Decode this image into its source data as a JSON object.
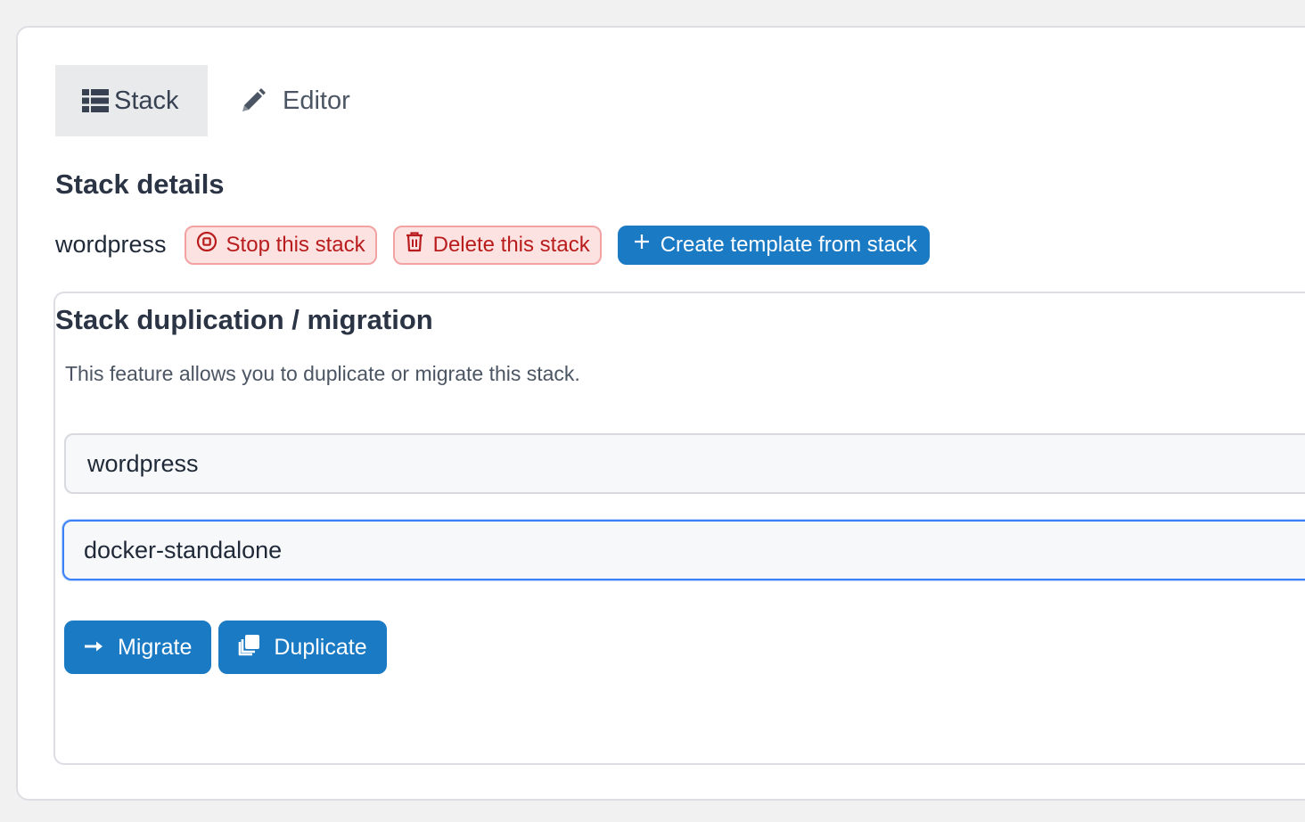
{
  "tabs": [
    {
      "label": "Stack",
      "icon": "list-icon",
      "active": true
    },
    {
      "label": "Editor",
      "icon": "pencil-icon",
      "active": false
    }
  ],
  "details": {
    "title": "Stack details",
    "stack_name": "wordpress",
    "stop_label": "Stop this stack",
    "delete_label": "Delete this stack",
    "template_label": "Create template from stack"
  },
  "migration": {
    "title": "Stack duplication / migration",
    "description": "This feature allows you to duplicate or migrate this stack.",
    "name_value": "wordpress",
    "environment_value": "docker-standalone",
    "migrate_label": "Migrate",
    "duplicate_label": "Duplicate"
  },
  "colors": {
    "primary": "#1b7ac4",
    "danger_bg": "#fde2e2",
    "danger_text": "#b91c1c",
    "focus": "#3b82f6"
  }
}
